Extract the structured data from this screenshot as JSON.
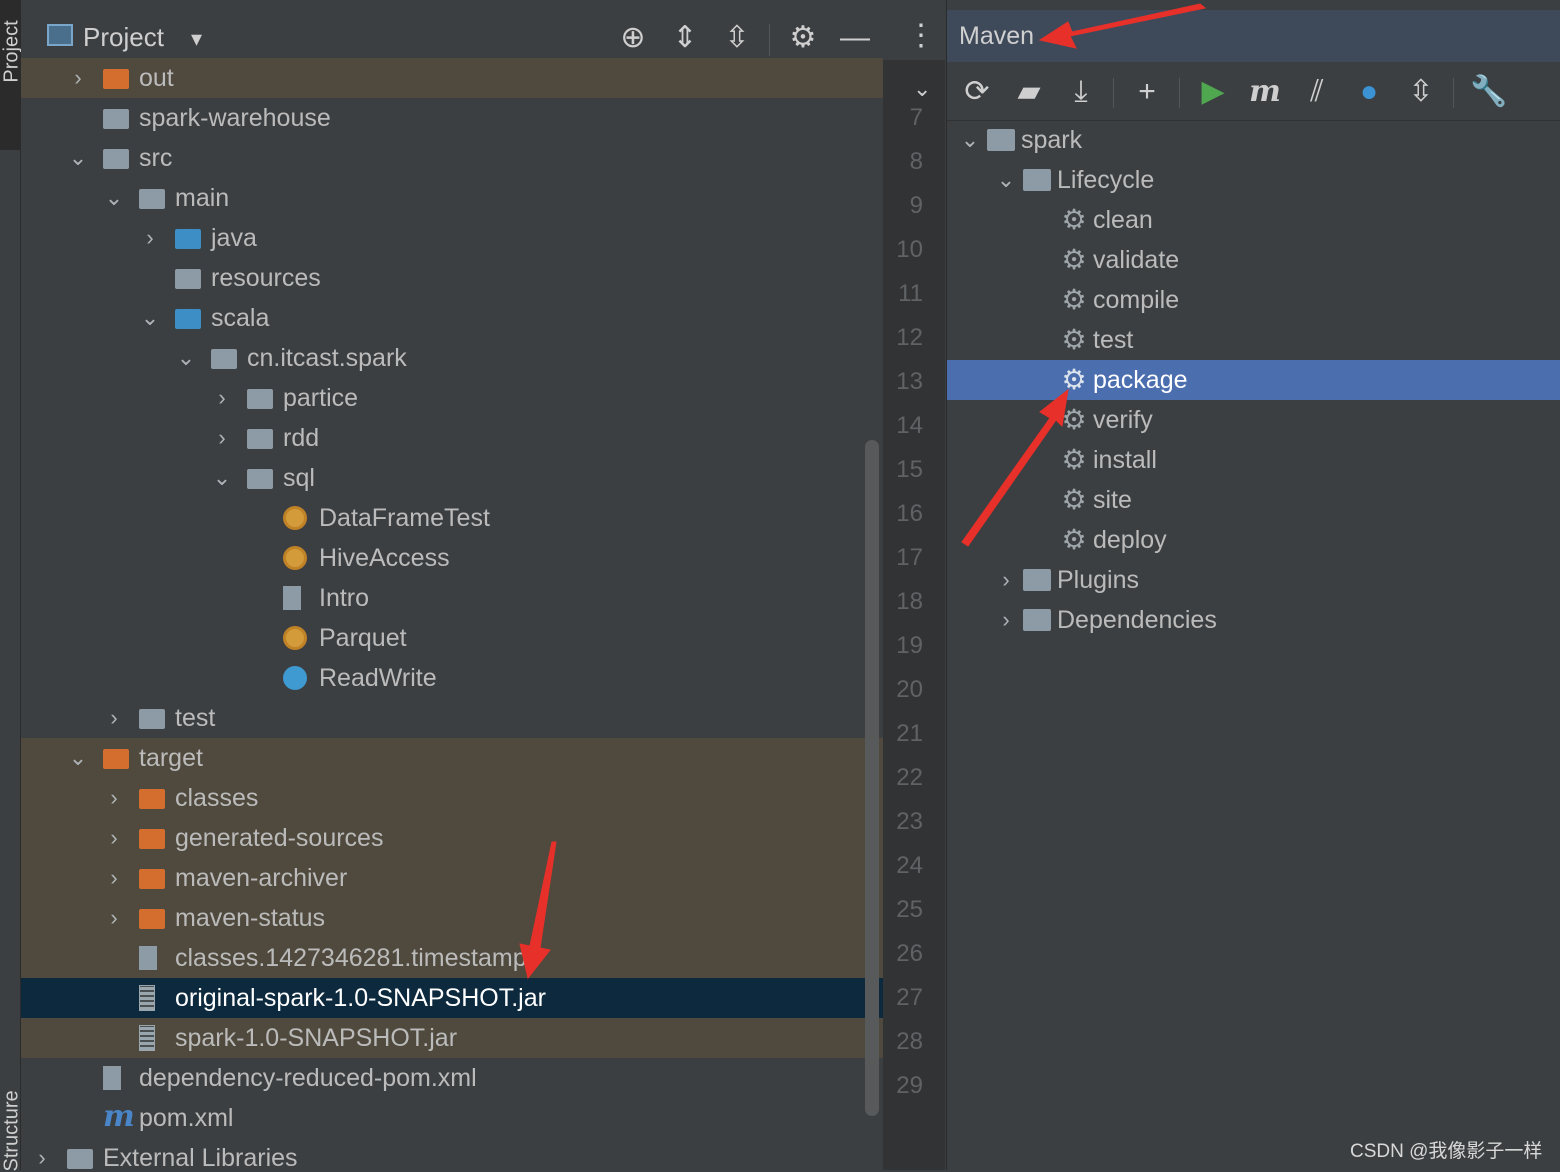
{
  "left_stripe": {
    "top_label": "Project",
    "bottom_label": "Structure"
  },
  "project_panel": {
    "title": "Project",
    "toolbar_icons": [
      "locate-icon",
      "expand-all-icon",
      "collapse-all-icon",
      "gear-icon",
      "minimize-icon",
      "more-options-icon"
    ],
    "tree": [
      {
        "label": "out",
        "expanded": false,
        "icon": "folder-orange-icon",
        "excluded": true
      },
      {
        "label": "spark-warehouse",
        "icon": "folder-icon"
      },
      {
        "label": "src",
        "expanded": true,
        "icon": "folder-icon"
      },
      {
        "label": "main",
        "expanded": true,
        "icon": "folder-icon"
      },
      {
        "label": "java",
        "expanded": false,
        "icon": "source-folder-icon"
      },
      {
        "label": "resources",
        "icon": "resources-folder-icon"
      },
      {
        "label": "scala",
        "expanded": true,
        "icon": "source-folder-icon"
      },
      {
        "label": "cn.itcast.spark",
        "expanded": true,
        "icon": "package-icon"
      },
      {
        "label": "partice",
        "expanded": false,
        "icon": "package-icon"
      },
      {
        "label": "rdd",
        "expanded": false,
        "icon": "package-icon"
      },
      {
        "label": "sql",
        "expanded": true,
        "icon": "package-icon"
      },
      {
        "label": "DataFrameTest",
        "icon": "scala-class-icon"
      },
      {
        "label": "HiveAccess",
        "icon": "scala-class-icon"
      },
      {
        "label": "Intro",
        "icon": "scala-file-icon"
      },
      {
        "label": "Parquet",
        "icon": "scala-class-icon"
      },
      {
        "label": "ReadWrite",
        "icon": "scala-object-icon"
      },
      {
        "label": "test",
        "expanded": false,
        "icon": "folder-icon"
      },
      {
        "label": "target",
        "expanded": true,
        "icon": "folder-orange-icon",
        "excluded": true
      },
      {
        "label": "classes",
        "expanded": false,
        "icon": "folder-orange-icon",
        "excluded": true
      },
      {
        "label": "generated-sources",
        "expanded": false,
        "icon": "folder-orange-icon",
        "excluded": true
      },
      {
        "label": "maven-archiver",
        "expanded": false,
        "icon": "folder-orange-icon",
        "excluded": true
      },
      {
        "label": "maven-status",
        "expanded": false,
        "icon": "folder-orange-icon",
        "excluded": true
      },
      {
        "label": "classes.1427346281.timestamp",
        "icon": "text-file-icon",
        "excluded": true
      },
      {
        "label": "original-spark-1.0-SNAPSHOT.jar",
        "icon": "jar-icon",
        "selected": true
      },
      {
        "label": "spark-1.0-SNAPSHOT.jar",
        "icon": "jar-icon",
        "excluded": true
      },
      {
        "label": "dependency-reduced-pom.xml",
        "icon": "xml-file-icon"
      },
      {
        "label": "pom.xml",
        "icon": "maven-icon"
      },
      {
        "label": "External Libraries",
        "expanded": false,
        "icon": "libraries-icon"
      }
    ]
  },
  "editor_gutter": {
    "line_numbers": [
      "7",
      "8",
      "9",
      "10",
      "11",
      "12",
      "13",
      "14",
      "15",
      "16",
      "17",
      "18",
      "19",
      "20",
      "21",
      "22",
      "23",
      "24",
      "25",
      "26",
      "27",
      "28",
      "29"
    ]
  },
  "maven_panel": {
    "title": "Maven",
    "toolbar_icons": [
      "reload-icon",
      "add-folder-icon",
      "download-icon",
      "plus-icon",
      "run-icon",
      "maven-goal-icon",
      "toggle-offline-icon",
      "skip-tests-icon",
      "collapse-icon",
      "settings-wrench-icon"
    ],
    "tree": [
      {
        "label": "spark",
        "expanded": true,
        "icon": "maven-project-icon"
      },
      {
        "label": "Lifecycle",
        "expanded": true,
        "icon": "lifecycle-folder-icon"
      },
      {
        "label": "clean",
        "icon": "gear-icon"
      },
      {
        "label": "validate",
        "icon": "gear-icon"
      },
      {
        "label": "compile",
        "icon": "gear-icon"
      },
      {
        "label": "test",
        "icon": "gear-icon"
      },
      {
        "label": "package",
        "icon": "gear-icon",
        "selected": true
      },
      {
        "label": "verify",
        "icon": "gear-icon"
      },
      {
        "label": "install",
        "icon": "gear-icon"
      },
      {
        "label": "site",
        "icon": "gear-icon"
      },
      {
        "label": "deploy",
        "icon": "gear-icon"
      },
      {
        "label": "Plugins",
        "expanded": false,
        "icon": "plugins-folder-icon"
      },
      {
        "label": "Dependencies",
        "expanded": false,
        "icon": "dependencies-folder-icon"
      }
    ]
  },
  "watermark": "CSDN @我像影子一样",
  "colors": {
    "panel_bg": "#3c3f41",
    "excluded_bg": "#4f4a3d",
    "selected_tree_bg": "#0d293e",
    "maven_selected_bg": "#4b6eaf",
    "annotation_red": "#e8302a"
  }
}
